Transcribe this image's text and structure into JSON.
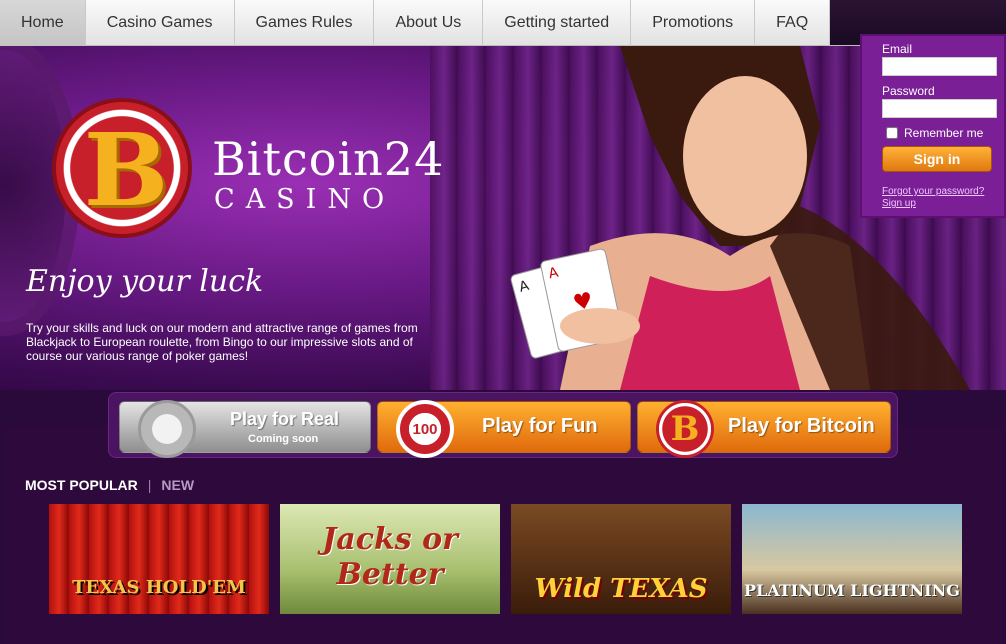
{
  "nav": {
    "items": [
      {
        "label": "Home",
        "active": true
      },
      {
        "label": "Casino Games"
      },
      {
        "label": "Games Rules"
      },
      {
        "label": "About Us"
      },
      {
        "label": "Getting started"
      },
      {
        "label": "Promotions"
      },
      {
        "label": "FAQ"
      }
    ]
  },
  "hero": {
    "brand_title": "Bitcoin24",
    "brand_sub": "CASINO",
    "logo_letter": "B",
    "tagline": "Enjoy your luck",
    "intro": "Try your skills and luck on our modern and attractive range of games from Blackjack to European roulette, from Bingo to our impressive slots and of course our various range of poker games!"
  },
  "login": {
    "email_label": "Email",
    "password_label": "Password",
    "remember_label": "Remember me",
    "signin_label": "Sign in",
    "forgot_label": "Forgot your password?",
    "signup_label": "Sign up"
  },
  "play": {
    "real_label": "Play for Real",
    "real_sub": "Coming soon",
    "fun_label": "Play for Fun",
    "fun_chip": "100",
    "btc_label": "Play for Bitcoin",
    "btc_chip": "B"
  },
  "games": {
    "tabs": [
      "MOST POPULAR",
      "NEW"
    ],
    "items": [
      {
        "title": "TEXAS HOLD'EM"
      },
      {
        "title": "Jacks or Better"
      },
      {
        "title": "Wild TEXAS"
      },
      {
        "title": "PLATINUM LIGHTNING"
      }
    ]
  },
  "colors": {
    "accent_orange": "#f09020",
    "brand_purple": "#7a1f96",
    "nav_bg": "#ececec"
  }
}
